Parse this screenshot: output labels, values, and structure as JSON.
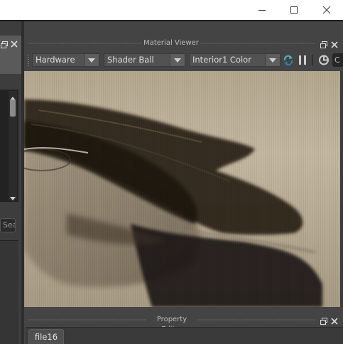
{
  "window": {
    "controls": [
      "minimize-icon",
      "maximize-icon",
      "close-icon"
    ]
  },
  "left_panel": {
    "search_text": "Sea"
  },
  "material_viewer": {
    "title": "Material Viewer",
    "renderer": {
      "value": "Hardware"
    },
    "geometry": {
      "value": "Shader Ball"
    },
    "lighting": {
      "value": "Interior1 Color"
    },
    "toolbar_icons": [
      "refresh-icon",
      "pause-icon",
      "settings-icon"
    ],
    "toolbar_more": "C"
  },
  "property_editor": {
    "title": "Property Editor",
    "tabs": [
      {
        "label": "file16"
      }
    ]
  },
  "colors": {
    "panel_bg": "#444444",
    "dropdown_bg": "#525252",
    "text": "#dddddd",
    "sepia_light": "#c2b6a0",
    "sepia_dark": "#2a2017"
  }
}
